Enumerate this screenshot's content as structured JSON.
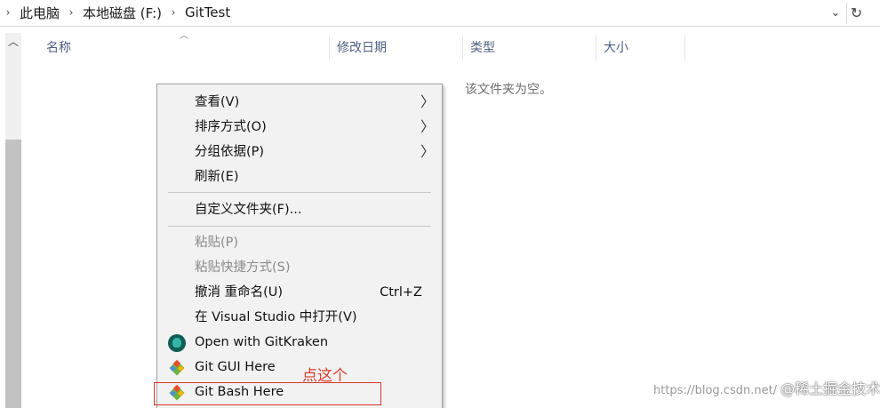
{
  "address": {
    "crumbs": [
      "此电脑",
      "本地磁盘 (F:)",
      "GitTest"
    ],
    "dropdown_glyph": "⌄",
    "refresh_glyph": "↻"
  },
  "columns": {
    "name": "名称",
    "modified": "修改日期",
    "type": "类型",
    "size": "大小"
  },
  "empty_message": "该文件夹为空。",
  "context_menu": {
    "items": [
      {
        "label": "查看(V)",
        "submenu": true
      },
      {
        "label": "排序方式(O)",
        "submenu": true
      },
      {
        "label": "分组依据(P)",
        "submenu": true
      },
      {
        "label": "刷新(E)"
      },
      {
        "label": "自定义文件夹(F)..."
      },
      {
        "label": "粘贴(P)",
        "disabled": true
      },
      {
        "label": "粘贴快捷方式(S)",
        "disabled": true
      },
      {
        "label": "撤消 重命名(U)",
        "shortcut": "Ctrl+Z"
      },
      {
        "label": "在 Visual Studio 中打开(V)"
      },
      {
        "label": "Open with GitKraken",
        "icon": "gitkraken-icon"
      },
      {
        "label": "Git GUI Here",
        "icon": "git-icon"
      },
      {
        "label": "Git Bash Here",
        "icon": "git-icon"
      }
    ],
    "submenu_glyph": "〉"
  },
  "annotation": "点这个",
  "watermark": {
    "url": "https://blog.csdn.net/",
    "brand": "@稀土掘金技术社区"
  },
  "colors": {
    "annotation": "#e03a2c",
    "menu_bg": "#f2f2f2",
    "header_text": "#4d6082"
  }
}
